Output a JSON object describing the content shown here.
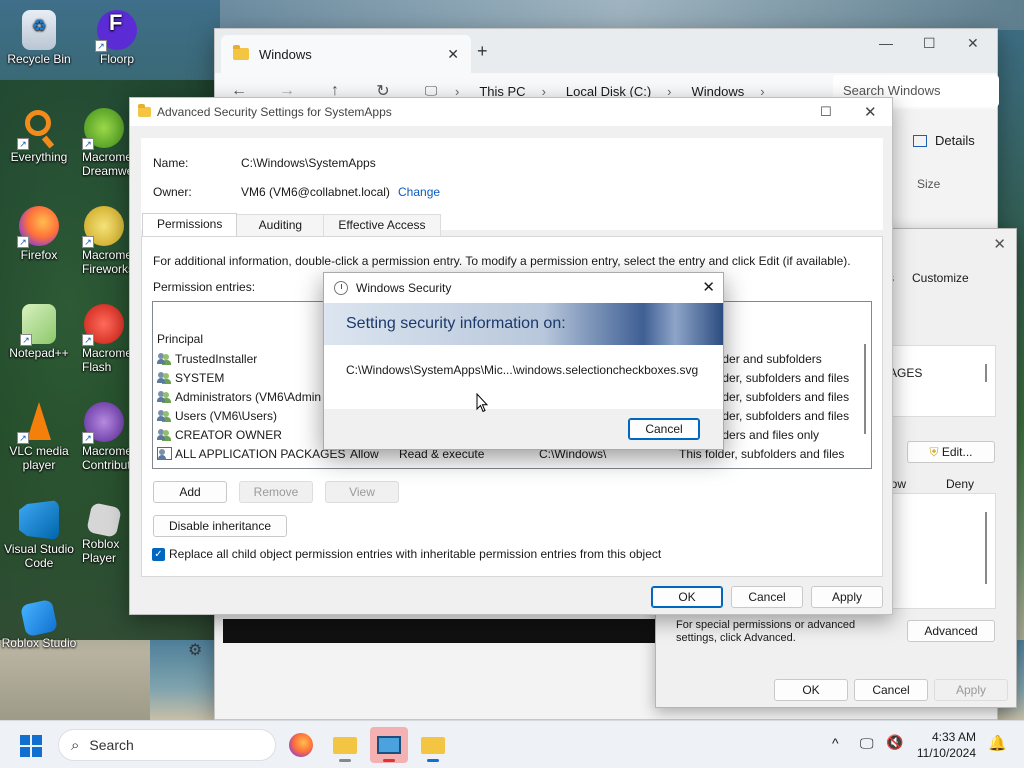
{
  "desktop": {
    "icons": [
      {
        "label": "Recycle Bin",
        "icon": "recycle-bin-icon"
      },
      {
        "label": "Floorp",
        "icon": "floorp-icon"
      },
      {
        "label": "Everything",
        "icon": "everything-icon"
      },
      {
        "label": "Macromedia Dreamweaver",
        "icon": "dreamweaver-icon"
      },
      {
        "label": "Firefox",
        "icon": "firefox-icon"
      },
      {
        "label": "Macromedia Fireworks",
        "icon": "fireworks-icon"
      },
      {
        "label": "Notepad++",
        "icon": "notepadpp-icon"
      },
      {
        "label": "Macromedia Flash",
        "icon": "flash-icon"
      },
      {
        "label": "VLC media player",
        "icon": "vlc-icon"
      },
      {
        "label": "Macromedia Contribute",
        "icon": "contribute-icon"
      },
      {
        "label": "Visual Studio Code",
        "icon": "vscode-icon"
      },
      {
        "label": "Roblox Player",
        "icon": "roblox-player-icon"
      },
      {
        "label": "Roblox Studio",
        "icon": "roblox-studio-icon"
      }
    ]
  },
  "explorer": {
    "tab_title": "Windows",
    "breadcrumbs": [
      "This PC",
      "Local Disk (C:)",
      "Windows"
    ],
    "search_placeholder": "Search Windows",
    "details_label": "Details",
    "size_header": "Size"
  },
  "props": {
    "tab_fragment": "s",
    "customize_tab": "Customize",
    "group_fragment": "AGES",
    "edit_label": "Edit...",
    "allow_header": "low",
    "deny_header": "Deny",
    "special_text": "For special permissions or advanced settings, click Advanced.",
    "advanced_label": "Advanced",
    "ok_label": "OK",
    "cancel_label": "Cancel",
    "apply_label": "Apply"
  },
  "advanced": {
    "title": "Advanced Security Settings for SystemApps",
    "name_label": "Name:",
    "name_value": "C:\\Windows\\SystemApps",
    "owner_label": "Owner:",
    "owner_value": "VM6 (VM6@collabnet.local)",
    "change_link": "Change",
    "tabs": [
      "Permissions",
      "Auditing",
      "Effective Access"
    ],
    "info_text": "For additional information, double-click a permission entry. To modify a permission entry, select the entry and click Edit (if available).",
    "entries_label": "Permission entries:",
    "principal_header": "Principal",
    "applies_header_fragment": "to",
    "entries": [
      {
        "principal": "TrustedInstaller",
        "applies": "older and subfolders"
      },
      {
        "principal": "SYSTEM",
        "applies": "older, subfolders and files"
      },
      {
        "principal": "Administrators (VM6\\Admin",
        "applies": "older, subfolders and files"
      },
      {
        "principal": "Users (VM6\\Users)",
        "applies": "older, subfolders and files"
      },
      {
        "principal": "CREATOR OWNER",
        "applies": "olders and files only"
      },
      {
        "principal": "ALL APPLICATION PACKAGES",
        "type": "Allow",
        "access": "Read & execute",
        "inherited": "C:\\Windows\\",
        "applies": "This folder, subfolders and files"
      }
    ],
    "add_label": "Add",
    "remove_label": "Remove",
    "view_label": "View",
    "disable_inheritance_label": "Disable inheritance",
    "replace_label": "Replace all child object permission entries with inheritable permission entries from this object",
    "ok_label": "OK",
    "cancel_label": "Cancel",
    "apply_label": "Apply"
  },
  "security_dialog": {
    "title": "Windows Security",
    "heading": "Setting security information on:",
    "path": "C:\\Windows\\SystemApps\\Mic...\\windows.selectioncheckboxes.svg",
    "cancel_label": "Cancel"
  },
  "taskbar": {
    "search_placeholder": "Search",
    "time": "4:33 AM",
    "date": "11/10/2024"
  },
  "colors": {
    "accent": "#0067c0",
    "link": "#0a5bc4",
    "banner_dark": "#2c4b80"
  }
}
